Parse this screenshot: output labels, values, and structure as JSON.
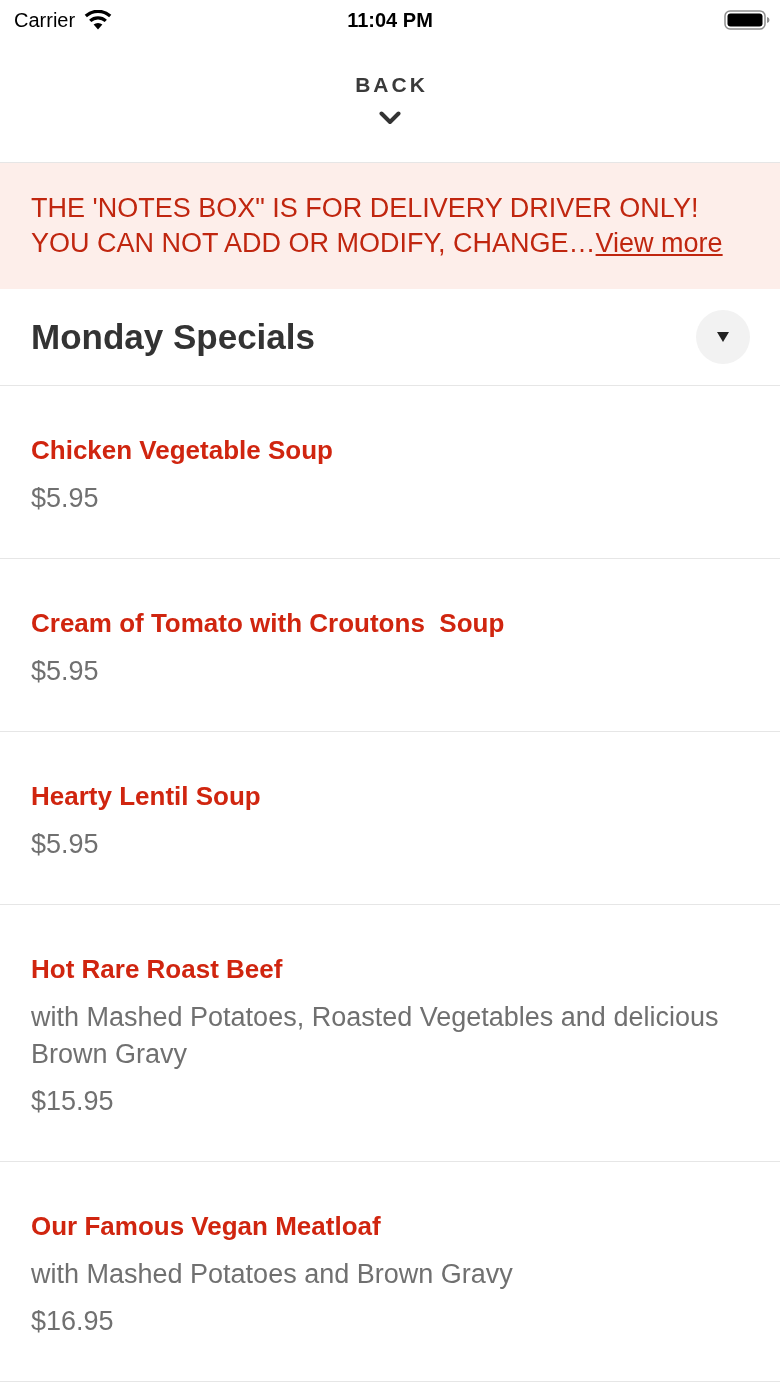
{
  "status_bar": {
    "carrier": "Carrier",
    "time": "11:04 PM"
  },
  "header": {
    "back_label": "BACK"
  },
  "notice": {
    "text": "THE 'NOTES BOX\" IS FOR DELIVERY DRIVER ONLY! YOU CAN NOT ADD OR MODIFY, CHANGE…",
    "link": "View more"
  },
  "section": {
    "title": "Monday Specials",
    "expanded": true
  },
  "items": [
    {
      "name": "Chicken Vegetable Soup",
      "price": "$5.95"
    },
    {
      "name": "Cream of Tomato with Croutons  Soup",
      "price": "$5.95"
    },
    {
      "name": "Hearty Lentil Soup",
      "price": "$5.95"
    },
    {
      "name": "Hot Rare Roast Beef",
      "description": "with Mashed Potatoes, Roasted Vegetables and delicious Brown Gravy",
      "price": "$15.95"
    },
    {
      "name": "Our Famous Vegan Meatloaf",
      "description": "with Mashed Potatoes and Brown Gravy",
      "price": "$16.95"
    }
  ]
}
